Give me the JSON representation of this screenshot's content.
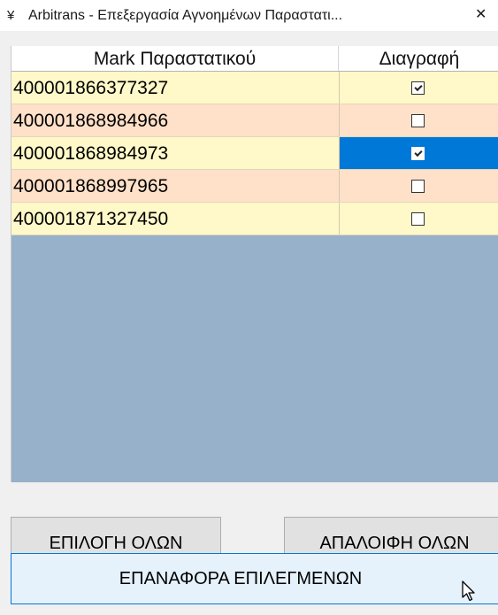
{
  "window": {
    "title": "Arbitrans - Επεξεργασία Αγνοημένων Παραστατι...",
    "close_glyph": "✕",
    "app_icon": "arbitrans-logo-icon",
    "app_icon_glyph": "¥"
  },
  "grid": {
    "columns": [
      "Mark Παραστατικού",
      "Διαγραφή"
    ],
    "rows": [
      {
        "mark": "400001866377327",
        "delete": true,
        "row_color": "#fff8c8",
        "selected": false
      },
      {
        "mark": "400001868984966",
        "delete": false,
        "row_color": "#ffe0c8",
        "selected": false
      },
      {
        "mark": "400001868984973",
        "delete": true,
        "row_color": "#fff8c8",
        "selected": true
      },
      {
        "mark": "400001868997965",
        "delete": false,
        "row_color": "#ffe0c8",
        "selected": false
      },
      {
        "mark": "400001871327450",
        "delete": false,
        "row_color": "#fff8c8",
        "selected": false
      }
    ],
    "empty_area_color": "#97b1cb",
    "selection_color": "#0078d7"
  },
  "buttons": {
    "select_all": "ΕΠΙΛΟΓΗ ΟΛΩΝ",
    "clear_all": "ΑΠΑΛΟΙΦΗ ΟΛΩΝ",
    "restore_selected": "ΕΠΑΝΑΦΟΡΑ ΕΠΙΛΕΓΜΕΝΩΝ"
  }
}
